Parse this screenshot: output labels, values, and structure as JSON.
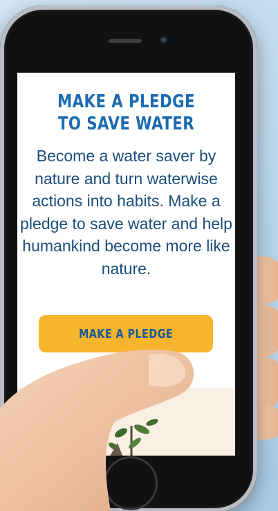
{
  "page": {
    "title": "MAKE A PLEDGE TO SAVE WATER",
    "body": "Become a water saver by nature and turn waterwise actions into habits. Make a pledge to save water and help humankind become more like nature.",
    "button_label": "MAKE A PLEDGE"
  },
  "colors": {
    "title": "#1b6bb3",
    "body_text": "#1a4d7c",
    "button_bg": "#f7b52e",
    "button_text": "#1b5a96",
    "lower_band": "#f9efe4",
    "background": "#c6dff2"
  },
  "icons": {
    "decorative": [
      "plant-image",
      "hand-image",
      "phone-device"
    ]
  }
}
